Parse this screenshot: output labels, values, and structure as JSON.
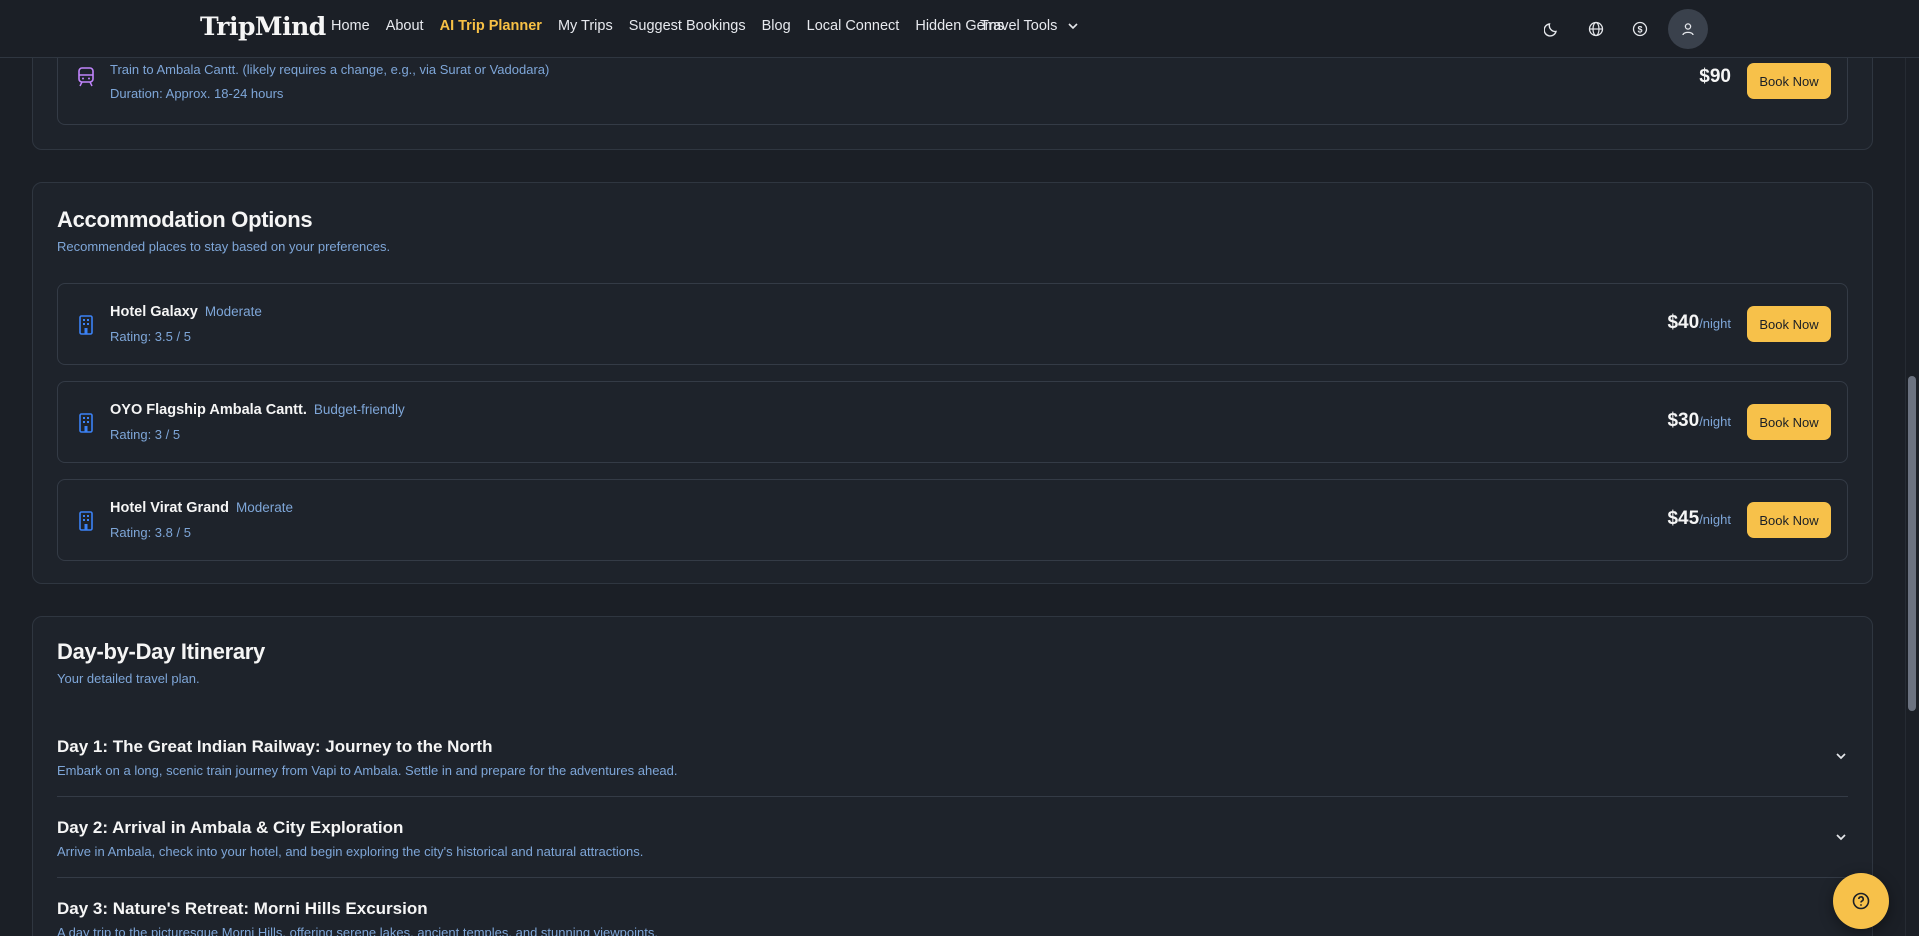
{
  "nav": {
    "brand": "TripMind",
    "links": [
      "Home",
      "About",
      "AI Trip Planner",
      "My Trips",
      "Suggest Bookings",
      "Blog",
      "Local Connect",
      "Hidden Gems"
    ],
    "active": "AI Trip Planner",
    "tools_label": "Travel Tools",
    "icons": [
      "moon-icon",
      "globe-icon",
      "dollar-icon",
      "user-icon"
    ]
  },
  "transport": {
    "description": "Train to Ambala Cantt. (likely requires a change, e.g., via Surat or Vadodara)",
    "duration": "Duration: Approx. 18-24 hours",
    "price": "$90",
    "book_label": "Book Now"
  },
  "accommodation": {
    "title": "Accommodation Options",
    "subtitle": "Recommended places to stay based on your preferences.",
    "items": [
      {
        "name": "Hotel Galaxy",
        "tier": "Moderate",
        "rating": "Rating: 3.5 / 5",
        "price": "$40",
        "unit": "/night",
        "book_label": "Book Now"
      },
      {
        "name": "OYO Flagship Ambala Cantt.",
        "tier": "Budget-friendly",
        "rating": "Rating: 3 / 5",
        "price": "$30",
        "unit": "/night",
        "book_label": "Book Now"
      },
      {
        "name": "Hotel Virat Grand",
        "tier": "Moderate",
        "rating": "Rating: 3.8 / 5",
        "price": "$45",
        "unit": "/night",
        "book_label": "Book Now"
      }
    ]
  },
  "itinerary": {
    "title": "Day-by-Day Itinerary",
    "subtitle": "Your detailed travel plan.",
    "days": [
      {
        "title": "Day 1: The Great Indian Railway: Journey to the North",
        "description": "Embark on a long, scenic train journey from Vapi to Ambala. Settle in and prepare for the adventures ahead."
      },
      {
        "title": "Day 2: Arrival in Ambala & City Exploration",
        "description": "Arrive in Ambala, check into your hotel, and begin exploring the city's historical and natural attractions."
      },
      {
        "title": "Day 3: Nature's Retreat: Morni Hills Excursion",
        "description": "A day trip to the picturesque Morni Hills, offering serene lakes, ancient temples, and stunning viewpoints."
      }
    ]
  },
  "colors": {
    "accent": "#f7c14a",
    "muted_text": "#7ea6d8",
    "background": "#1b1f26"
  }
}
